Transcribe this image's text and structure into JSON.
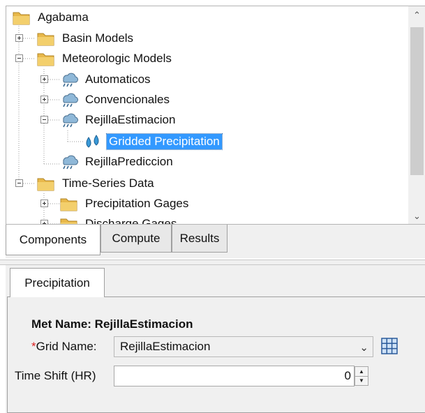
{
  "tree": {
    "items": [
      {
        "label": "Agabama",
        "icon": "folder-icon"
      },
      {
        "label": "Basin Models",
        "icon": "folder-icon"
      },
      {
        "label": "Meteorologic Models",
        "icon": "folder-icon"
      },
      {
        "label": "Automaticos",
        "icon": "rain-cloud-icon"
      },
      {
        "label": "Convencionales",
        "icon": "rain-cloud-icon"
      },
      {
        "label": "RejillaEstimacion",
        "icon": "rain-cloud-icon"
      },
      {
        "label": "Gridded Precipitation",
        "icon": "water-drops-icon",
        "selected": true
      },
      {
        "label": "RejillaPrediccion",
        "icon": "rain-cloud-icon"
      },
      {
        "label": "Time-Series Data",
        "icon": "folder-icon"
      },
      {
        "label": "Precipitation Gages",
        "icon": "folder-icon"
      },
      {
        "label": "Discharge Gages",
        "icon": "folder-icon"
      }
    ]
  },
  "tabs": {
    "components": "Components",
    "compute": "Compute",
    "results": "Results"
  },
  "editor": {
    "tab_label": "Precipitation",
    "met_name": "Met Name: RejillaEstimacion",
    "required_mark": "*",
    "grid_name_label": "Grid Name:",
    "grid_name_value": "RejillaEstimacion",
    "time_shift_label": "Time Shift (HR)",
    "time_shift_value": "0"
  },
  "colors": {
    "selection": "#3399ff",
    "folder": "#e8b84a",
    "required": "#d22222"
  }
}
